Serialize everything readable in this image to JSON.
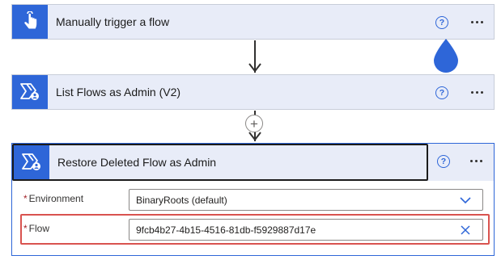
{
  "steps": [
    {
      "title": "Manually trigger a flow",
      "icon": "hand-touch-icon",
      "help": "?"
    },
    {
      "title": "List Flows as Admin (V2)",
      "icon": "power-automate-admin-icon",
      "help": "?"
    }
  ],
  "add_step_glyph": "+",
  "expanded_step": {
    "title": "Restore Deleted Flow as Admin",
    "icon": "power-automate-admin-icon",
    "help": "?",
    "fields": [
      {
        "required_mark": "*",
        "label": "Environment",
        "value": "BinaryRoots (default)",
        "control": "chevron-down-icon"
      },
      {
        "required_mark": "*",
        "label": "Flow",
        "value": "9fcb4b27-4b15-4516-81db-f5929887d17e",
        "control": "clear-icon"
      }
    ]
  },
  "colors": {
    "accent": "#2e66d8",
    "card_background": "#e8ecf8",
    "highlight": "#d9534f",
    "required": "#a4262c"
  }
}
